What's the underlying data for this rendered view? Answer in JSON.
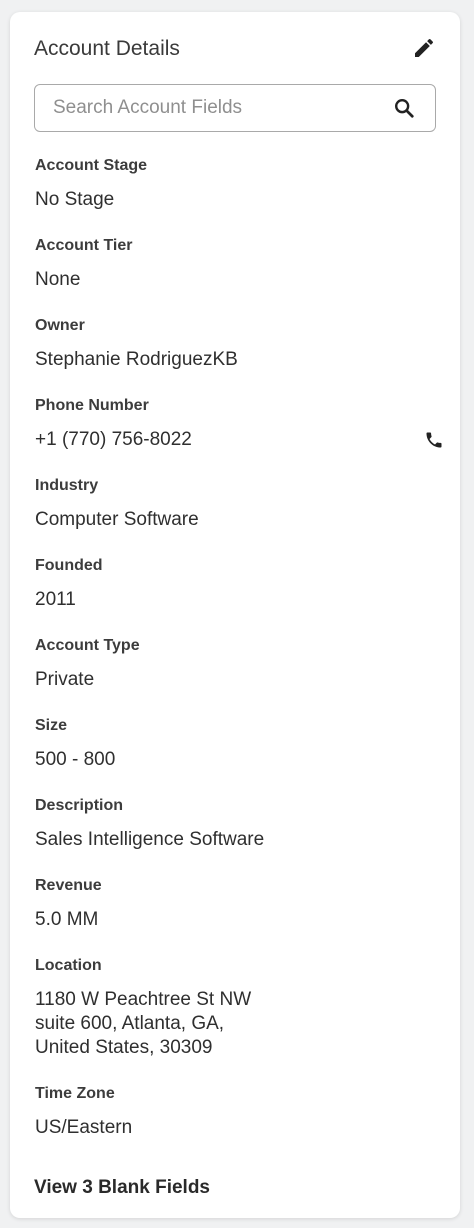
{
  "card": {
    "title": "Account Details",
    "edit_icon": "pencil-icon"
  },
  "search": {
    "placeholder": "Search Account Fields",
    "value": "",
    "icon": "search-icon"
  },
  "fields": [
    {
      "label": "Account Stage",
      "value": "No Stage"
    },
    {
      "label": "Account Tier",
      "value": "None"
    },
    {
      "label": "Owner",
      "value": "Stephanie RodriguezKB"
    },
    {
      "label": "Phone Number",
      "value": "+1 (770) 756-8022",
      "icon": "phone-icon"
    },
    {
      "label": "Industry",
      "value": "Computer Software"
    },
    {
      "label": "Founded",
      "value": "2011"
    },
    {
      "label": "Account Type",
      "value": "Private"
    },
    {
      "label": "Size",
      "value": "500 - 800"
    },
    {
      "label": "Description",
      "value": "Sales Intelligence Software"
    },
    {
      "label": "Revenue",
      "value": "5.0 MM"
    },
    {
      "label": "Location",
      "value": "1180 W Peachtree St NW\nsuite 600, Atlanta, GA,\nUnited States, 30309"
    },
    {
      "label": "Time Zone",
      "value": "US/Eastern"
    }
  ],
  "footer": {
    "link_label": "View 3 Blank Fields"
  },
  "colors": {
    "background": "#f0f1f2",
    "card": "#ffffff",
    "text": "#2f2f2f",
    "border": "#a9a9a9"
  }
}
